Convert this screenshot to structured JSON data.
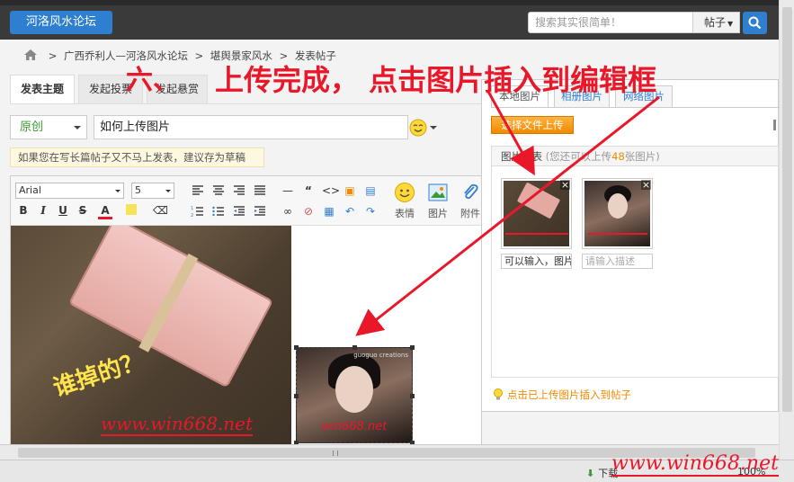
{
  "header": {
    "logo_label": "河洛风水论坛",
    "search_placeholder": "搜索其实很简单！",
    "search_scope": "帖子"
  },
  "breadcrumb": {
    "items": [
      "广西乔利人—河洛风水论坛",
      "堪舆景家风水",
      "发表帖子"
    ],
    "separator": ">"
  },
  "tabs": [
    {
      "label": "发表主题",
      "active": true
    },
    {
      "label": "发起投票",
      "active": false
    },
    {
      "label": "发起悬赏",
      "active": false
    }
  ],
  "post": {
    "type_value": "原创",
    "title_value": "如何上传图片",
    "draft_tip": "如果您在写长篇帖子又不马上发表，建议存为草稿"
  },
  "editor": {
    "font_name": "Arial",
    "font_size": "5",
    "btn_emoticon": "表情",
    "btn_image": "图片",
    "btn_attach": "附件",
    "image1_caption": "谁掉的？",
    "image1_watermark": "www.win668.net",
    "image2_watermark": "win668.net",
    "image2_credit": "guoguo creations"
  },
  "upload_panel": {
    "tabs": [
      "本地图片",
      "相册图片",
      "网络图片"
    ],
    "select_file_btn": "选择文件上传",
    "list_title": "图片列表",
    "list_note_prefix": "(您还可以上传",
    "list_note_count": "48",
    "list_note_suffix": "张图片)",
    "thumb1_desc": "可以输入，图片",
    "thumb2_placeholder": "请输入描述",
    "tip": "点击已上传图片插入到帖子"
  },
  "annotation": {
    "step": "六、",
    "text": "上传完成，  点击图片插入到编辑框"
  },
  "statusbar": {
    "download_label": "下载",
    "zoom": "100%"
  },
  "watermark": "www.win668.net",
  "colors": {
    "brand_blue": "#2f7fd0",
    "annotation_red": "#e8182a",
    "orange": "#f08a00",
    "green": "#3a9b36"
  }
}
